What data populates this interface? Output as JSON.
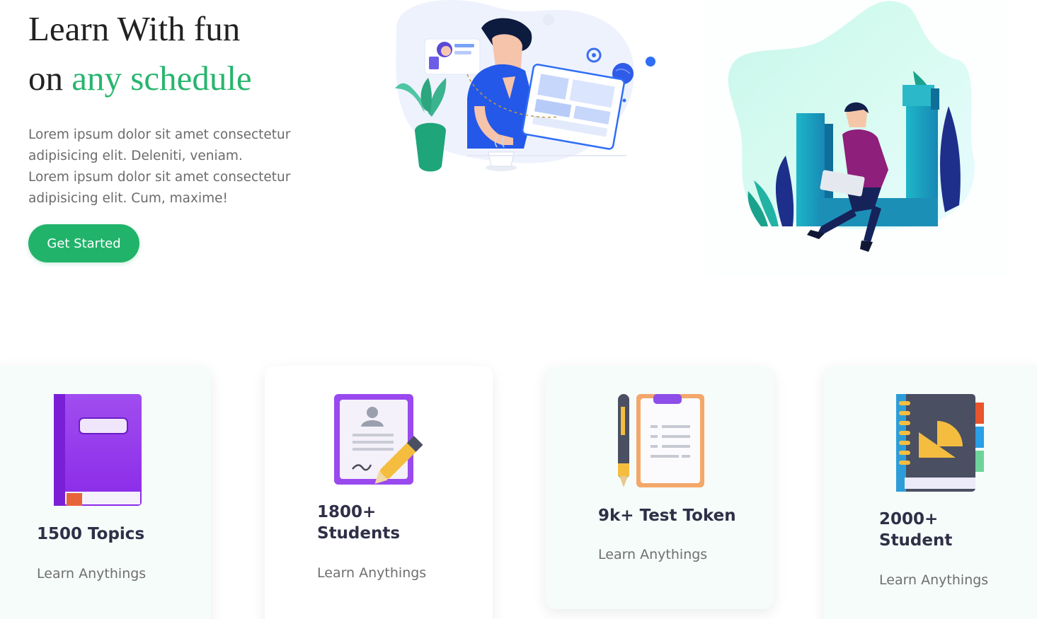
{
  "hero": {
    "title_line1": "Learn With fun",
    "title_line2_prefix": "on ",
    "title_line2_accent": "any schedule",
    "description_line1": "Lorem ipsum dolor sit amet consectetur",
    "description_line2": "adipisicing elit. Deleniti, veniam.",
    "description_line3": "Lorem ipsum dolor sit amet consectetur",
    "description_line4": "adipisicing elit. Cum, maxime!",
    "cta_label": "Get Started",
    "accent_color": "#27b56e"
  },
  "illustrations": [
    {
      "icon": "person-at-screen-illustration"
    },
    {
      "icon": "person-with-laptop-illustration"
    }
  ],
  "stats": [
    {
      "icon": "book-icon",
      "title": "1500 Topics",
      "subtitle": "Learn Anythings"
    },
    {
      "icon": "certificate-icon",
      "title": "1800+\nStudents",
      "subtitle": "Learn Anythings"
    },
    {
      "icon": "clipboard-icon",
      "title": "9k+ Test Token",
      "subtitle": "Learn Anythings"
    },
    {
      "icon": "notebook-icon",
      "title": "2000+\nStudent",
      "subtitle": "Learn Anythings"
    }
  ]
}
